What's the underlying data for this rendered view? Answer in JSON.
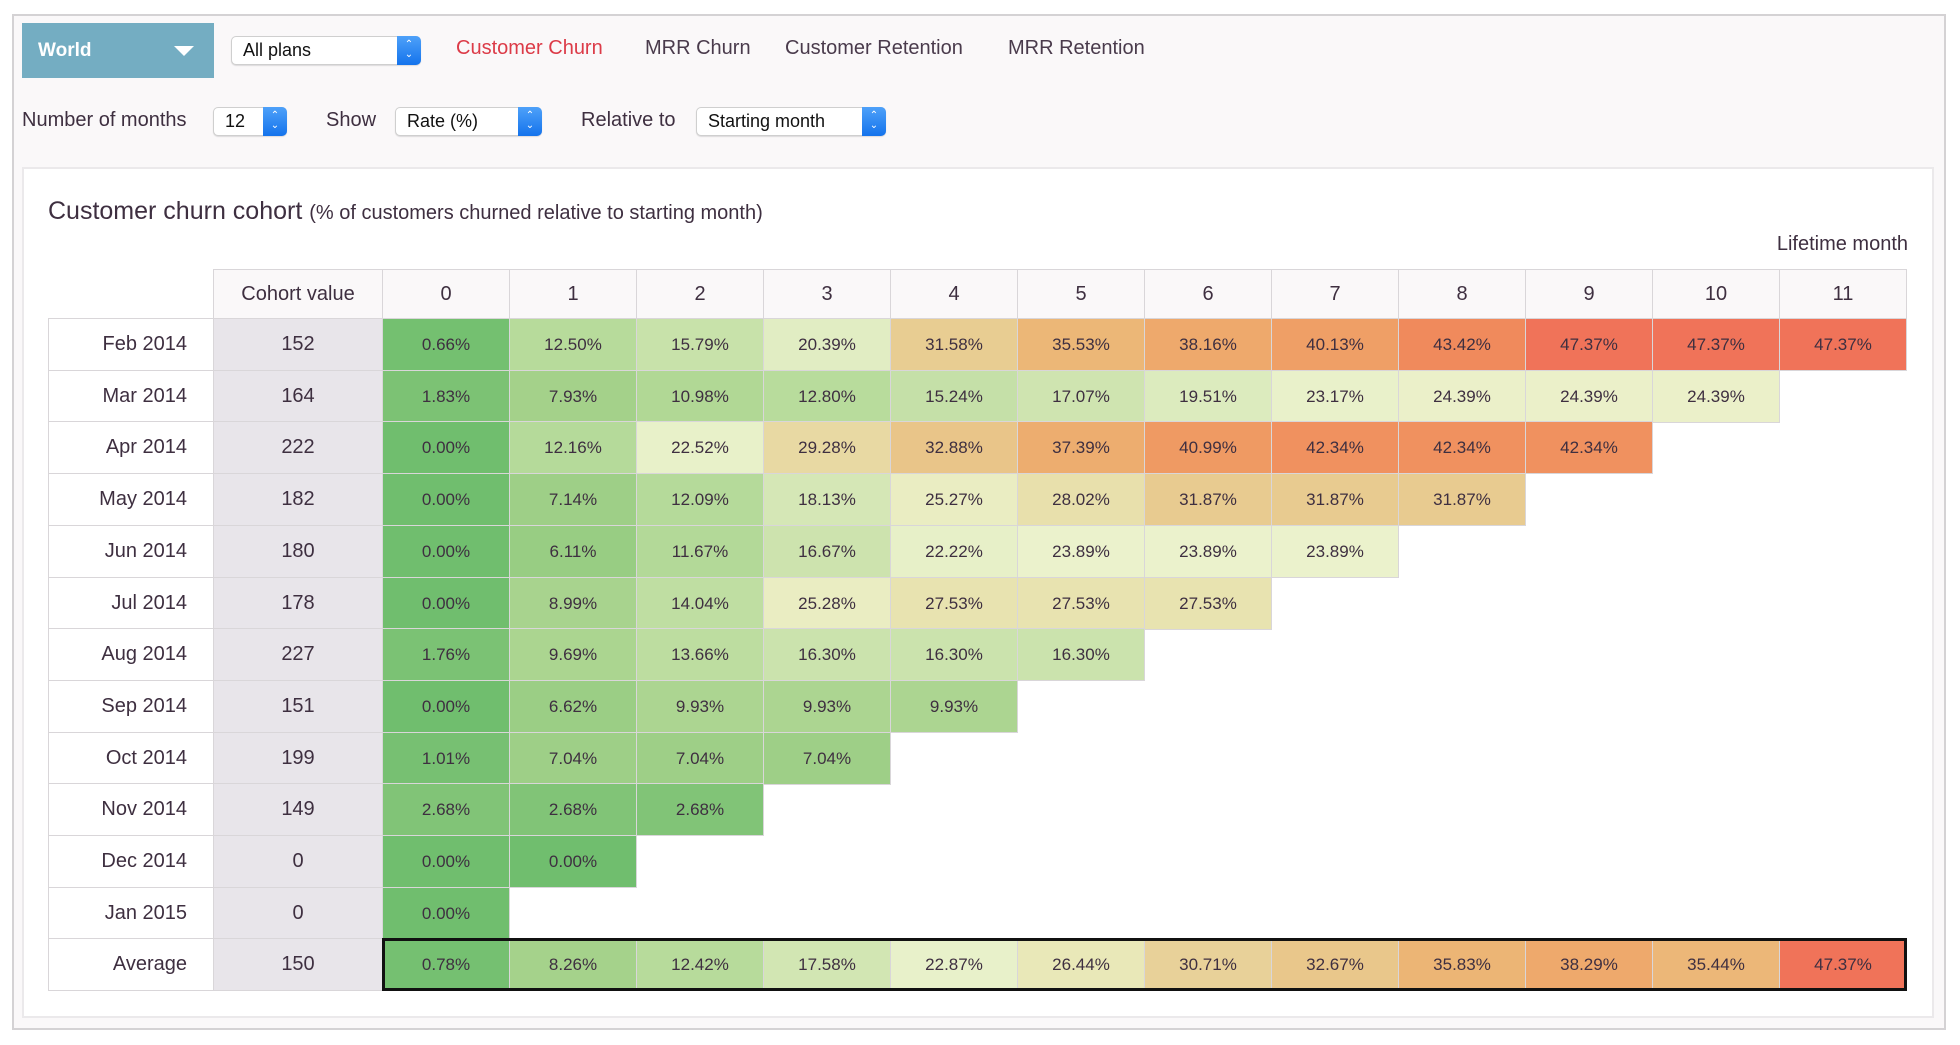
{
  "toolbar": {
    "region": "World",
    "plan_select": "All plans",
    "tabs": [
      {
        "label": "Customer Churn",
        "active": true
      },
      {
        "label": "MRR Churn",
        "active": false
      },
      {
        "label": "Customer Retention",
        "active": false
      },
      {
        "label": "MRR Retention",
        "active": false
      }
    ],
    "months_label": "Number of months",
    "months_value": "12",
    "show_label": "Show",
    "show_value": "Rate (%)",
    "relative_label": "Relative to",
    "relative_value": "Starting month"
  },
  "chart_data": {
    "type": "heatmap",
    "title": "Customer churn cohort",
    "subtitle": "(% of customers churned relative to starting month)",
    "xlabel": "Lifetime month",
    "cohort_header": "Cohort value",
    "columns": [
      "0",
      "1",
      "2",
      "3",
      "4",
      "5",
      "6",
      "7",
      "8",
      "9",
      "10",
      "11"
    ],
    "rows": [
      {
        "label": "Feb 2014",
        "cohort": "152",
        "values": [
          0.66,
          12.5,
          15.79,
          20.39,
          31.58,
          35.53,
          38.16,
          40.13,
          43.42,
          47.37,
          47.37,
          47.37
        ]
      },
      {
        "label": "Mar 2014",
        "cohort": "164",
        "values": [
          1.83,
          7.93,
          10.98,
          12.8,
          15.24,
          17.07,
          19.51,
          23.17,
          24.39,
          24.39,
          24.39
        ]
      },
      {
        "label": "Apr 2014",
        "cohort": "222",
        "values": [
          0.0,
          12.16,
          22.52,
          29.28,
          32.88,
          37.39,
          40.99,
          42.34,
          42.34,
          42.34
        ]
      },
      {
        "label": "May 2014",
        "cohort": "182",
        "values": [
          0.0,
          7.14,
          12.09,
          18.13,
          25.27,
          28.02,
          31.87,
          31.87,
          31.87
        ]
      },
      {
        "label": "Jun 2014",
        "cohort": "180",
        "values": [
          0.0,
          6.11,
          11.67,
          16.67,
          22.22,
          23.89,
          23.89,
          23.89
        ]
      },
      {
        "label": "Jul 2014",
        "cohort": "178",
        "values": [
          0.0,
          8.99,
          14.04,
          25.28,
          27.53,
          27.53,
          27.53
        ]
      },
      {
        "label": "Aug 2014",
        "cohort": "227",
        "values": [
          1.76,
          9.69,
          13.66,
          16.3,
          16.3,
          16.3
        ]
      },
      {
        "label": "Sep 2014",
        "cohort": "151",
        "values": [
          0.0,
          6.62,
          9.93,
          9.93,
          9.93
        ]
      },
      {
        "label": "Oct 2014",
        "cohort": "199",
        "values": [
          1.01,
          7.04,
          7.04,
          7.04
        ]
      },
      {
        "label": "Nov 2014",
        "cohort": "149",
        "values": [
          2.68,
          2.68,
          2.68
        ]
      },
      {
        "label": "Dec 2014",
        "cohort": "0",
        "values": [
          0.0,
          0.0
        ]
      },
      {
        "label": "Jan 2015",
        "cohort": "0",
        "values": [
          0.0
        ]
      }
    ],
    "average": {
      "label": "Average",
      "cohort": "150",
      "values": [
        0.78,
        8.26,
        12.42,
        17.58,
        22.87,
        26.44,
        30.71,
        32.67,
        35.83,
        38.29,
        35.44,
        47.37
      ]
    },
    "color_scale": [
      {
        "v": 0,
        "c": "#70be6e"
      },
      {
        "v": 8,
        "c": "#a4d18a"
      },
      {
        "v": 13,
        "c": "#b9dc9d"
      },
      {
        "v": 17,
        "c": "#cfe4b0"
      },
      {
        "v": 21,
        "c": "#e4efc6"
      },
      {
        "v": 24,
        "c": "#ebf2cc"
      },
      {
        "v": 27.5,
        "c": "#e8e3b0"
      },
      {
        "v": 31.5,
        "c": "#e8cd93"
      },
      {
        "v": 36,
        "c": "#ecb474"
      },
      {
        "v": 40,
        "c": "#efa066"
      },
      {
        "v": 43.4,
        "c": "#f08a5c"
      },
      {
        "v": 47.4,
        "c": "#f07359"
      }
    ]
  }
}
